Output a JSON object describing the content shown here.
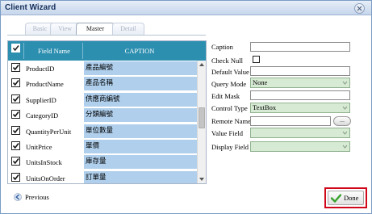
{
  "window": {
    "title": "Client Wizard"
  },
  "tabs": [
    {
      "label": "Basic",
      "active": false
    },
    {
      "label": "View",
      "active": false
    },
    {
      "label": "Master",
      "active": true
    },
    {
      "label": "Detail",
      "active": false
    }
  ],
  "grid": {
    "headers": {
      "check_all": true,
      "field_name": "Field Name",
      "caption": "CAPTION"
    },
    "rows": [
      {
        "checked": true,
        "field": "ProductID",
        "caption": "產品編號"
      },
      {
        "checked": true,
        "field": "ProductName",
        "caption": "產品名稱"
      },
      {
        "checked": true,
        "field": "SupplierID",
        "caption": "供應商編號"
      },
      {
        "checked": true,
        "field": "CategoryID",
        "caption": "分類編號"
      },
      {
        "checked": true,
        "field": "QuantityPerUnit",
        "caption": "單位數量"
      },
      {
        "checked": true,
        "field": "UnitPrice",
        "caption": "單價"
      },
      {
        "checked": true,
        "field": "UnitsInStock",
        "caption": "庫存量"
      },
      {
        "checked": true,
        "field": "UnitsOnOrder",
        "caption": "訂單量"
      }
    ]
  },
  "properties": {
    "caption": {
      "label": "Caption",
      "value": ""
    },
    "check_null": {
      "label": "Check Null",
      "checked": false
    },
    "default_value": {
      "label": "Default Value",
      "value": ""
    },
    "query_mode": {
      "label": "Query Mode",
      "value": "None"
    },
    "edit_mask": {
      "label": "Edit Mask",
      "value": ""
    },
    "control_type": {
      "label": "Control Type",
      "value": "TextBox"
    },
    "remote_name": {
      "label": "Remote Name",
      "value": "",
      "browse_label": "..."
    },
    "value_field": {
      "label": "Value Field",
      "value": ""
    },
    "display_field": {
      "label": "Display Field",
      "value": ""
    }
  },
  "footer": {
    "previous_label": "Previous",
    "done_label": "Done"
  },
  "colors": {
    "header_bg": "#2d8fb0",
    "caption_cell_bg": "#afcfec",
    "select_bg": "#d7ead3",
    "highlight_border": "#d0061a"
  }
}
